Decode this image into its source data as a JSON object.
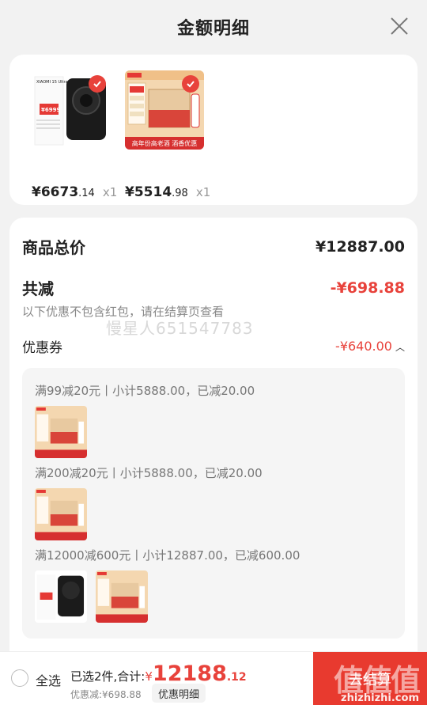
{
  "header": {
    "title": "金额明细"
  },
  "products": [
    {
      "price_int": "¥6673",
      "price_dec": ".14",
      "qty": "x1",
      "brand": "XIAOMI 15 Ultra",
      "tag": "¥6999"
    },
    {
      "price_int": "¥5514",
      "price_dec": ".98",
      "qty": "x1",
      "banner": "高年份高老酒 酒香优惠",
      "side_labels": [
        "京东自营",
        "品质",
        "陈香柔和",
        "醇厚爽净",
        "甘润香醇"
      ]
    }
  ],
  "summary": {
    "total_label": "商品总价",
    "total_value": "¥12887.00",
    "reduce_label": "共减",
    "reduce_value": "-¥698.88",
    "note": "以下优惠不包含红包，请在结算页查看",
    "watermark": "慢星人651547783",
    "coupon_label": "优惠券",
    "coupon_value": "-¥640.00"
  },
  "coupons": [
    {
      "text": "满99减20元丨小计5888.00，已减20.00"
    },
    {
      "text": "满200减20元丨小计5888.00，已减20.00"
    },
    {
      "text": "满12000减600元丨小计12887.00，已减600.00"
    }
  ],
  "bottom": {
    "select_all": "全选",
    "selected_label": "已选2件,合计:",
    "currency": "¥",
    "total_int": "12188",
    "total_dec": ".12",
    "discount": "优惠减:¥698.88",
    "detail_chip": "优惠明细",
    "checkout": "去结算",
    "logo": "值值值",
    "site": "zhizhizhi.com"
  },
  "colors": {
    "accent": "#e8423b",
    "checkout": "#e83a2f"
  }
}
